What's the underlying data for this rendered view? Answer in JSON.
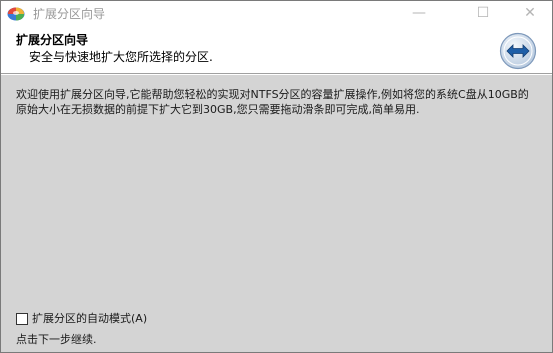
{
  "window": {
    "title": "扩展分区向导",
    "minimize_glyph": "—",
    "maximize_glyph": "☐",
    "close_glyph": "✕"
  },
  "header": {
    "title": "扩展分区向导",
    "subtitle": "安全与快速地扩大您所选择的分区.",
    "icon": "extend-arrows-icon"
  },
  "content": {
    "description": "欢迎使用扩展分区向导,它能帮助您轻松的实现对NTFS分区的容量扩展操作,例如将您的系统C盘从10GB的原始大小在无损数据的前提下扩大它到30GB,您只需要拖动滑条即可完成,简单易用.",
    "auto_mode_label": "扩展分区的自动模式(A)",
    "auto_mode_checked": false,
    "next_hint": "点击下一步继续."
  },
  "colors": {
    "content_bg": "#d4d4d4",
    "icon_blue": "#1f5fa8"
  }
}
